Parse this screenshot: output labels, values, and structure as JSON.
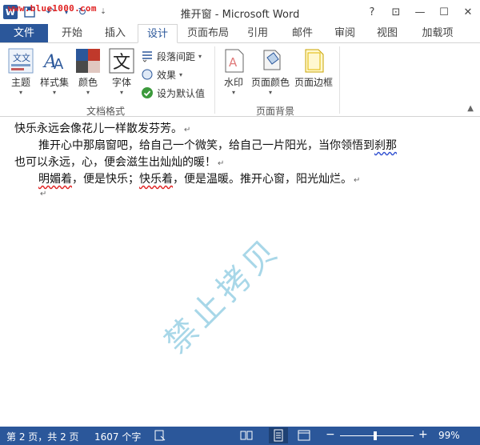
{
  "titlebar": {
    "watermark_url": "www.blue1000.com",
    "title": "推开窗 - Microsoft Word",
    "help": "?",
    "restore_ribbon": "⊡",
    "minimize": "—",
    "maximize": "☐",
    "close": "✕"
  },
  "tabs": [
    "文件",
    "开始",
    "插入",
    "设计",
    "页面布局",
    "引用",
    "邮件",
    "审阅",
    "视图",
    "加载项"
  ],
  "ribbon": {
    "theme": "主题",
    "style_set": "样式集",
    "colors": "颜色",
    "fonts": "字体",
    "paragraph_spacing": "段落间距",
    "effects": "效果",
    "set_default": "设为默认值",
    "group_doc_format": "文档格式",
    "watermark": "水印",
    "page_color": "页面颜色",
    "page_borders": "页面边框",
    "group_page_bg": "页面背景",
    "collapse": "▲"
  },
  "document": {
    "line1": "快乐永远会像花儿一样散发芬芳。",
    "line2a": "推开心中那扇窗吧，给自己一个微笑，给自己一片阳光，当你领悟到",
    "line2b": "刹那",
    "line3": "也可以永远，心，便会滋生出灿灿的暖！",
    "line4a": "明媚着",
    "line4b": "，便是快乐；",
    "line4c": "快乐着",
    "line4d": "，便是温暖。推开心窗，阳光灿烂。",
    "para_mark": "↵",
    "watermark_text": "禁止拷贝"
  },
  "status": {
    "pages": "第 2 页，共 2 页",
    "words": "1607 个字",
    "zoom_minus": "−",
    "zoom_plus": "+",
    "zoom": "99%"
  },
  "colors": {
    "accent": "#2b579a",
    "watermark": "#9fd3e6",
    "spell_error": "#e02020"
  }
}
